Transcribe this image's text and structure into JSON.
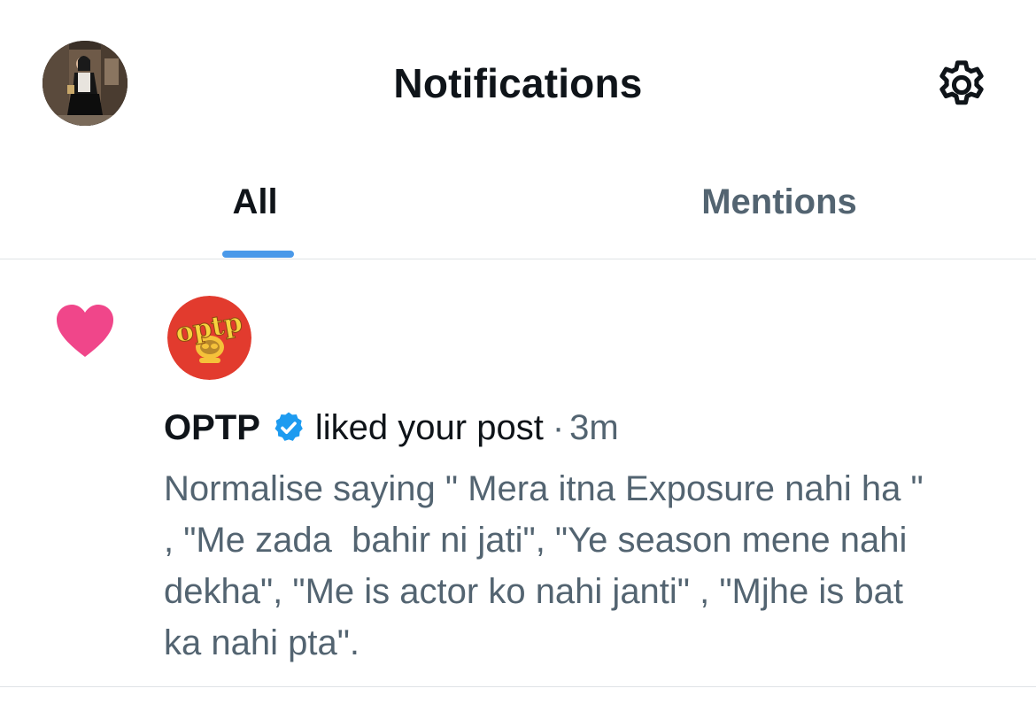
{
  "header": {
    "title": "Notifications",
    "avatar_icon": "profile-photo",
    "settings_icon": "gear-icon"
  },
  "tabs": [
    {
      "label": "All",
      "active": true
    },
    {
      "label": "Mentions",
      "active": false
    }
  ],
  "notification": {
    "type_icon": "heart-icon",
    "type_color": "#f0468a",
    "brand_logo_text": "optp",
    "brand_color": "#e23b2e",
    "user_name": "OPTP",
    "verified": true,
    "verified_color": "#1d9bf0",
    "action": "liked your post",
    "separator": "·",
    "time": "3m",
    "post_text": "Normalise saying \" Mera itna Exposure nahi ha \"\n, \"Me zada  bahir ni jati\", \"Ye season mene nahi\ndekha\", \"Me is actor ko nahi janti\" , \"Mjhe is bat\nka nahi pta\"."
  },
  "colors": {
    "accent": "#4a99e9",
    "text_primary": "#0f1419",
    "text_secondary": "#536471",
    "divider": "#dfe3e6"
  }
}
